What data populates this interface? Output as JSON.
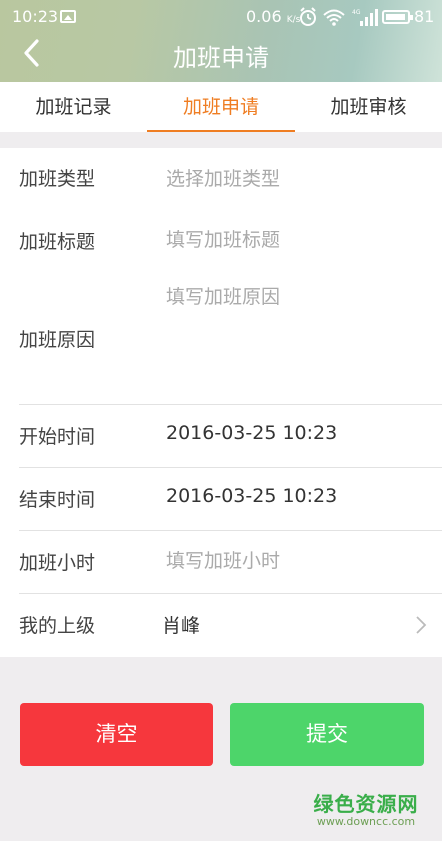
{
  "status_bar": {
    "time": "10:23",
    "net_speed": "0.06",
    "net_unit": "K/s",
    "signal_tag": "4G",
    "battery": "81"
  },
  "nav": {
    "title": "加班申请",
    "back_icon": "chevron-left-icon"
  },
  "tabs": [
    {
      "label": "加班记录",
      "active": false
    },
    {
      "label": "加班申请",
      "active": true
    },
    {
      "label": "加班审核",
      "active": false
    }
  ],
  "form": {
    "type": {
      "label": "加班类型",
      "placeholder": "选择加班类型"
    },
    "title": {
      "label": "加班标题",
      "placeholder": "填写加班标题"
    },
    "reason": {
      "label": "加班原因",
      "placeholder": "填写加班原因"
    },
    "start": {
      "label": "开始时间",
      "value": "2016-03-25 10:23"
    },
    "end": {
      "label": "结束时间",
      "value": "2016-03-25 10:23"
    },
    "hours": {
      "label": "加班小时",
      "placeholder": "填写加班小时"
    },
    "superior": {
      "label": "我的上级",
      "value": "肖峰"
    }
  },
  "buttons": {
    "clear": "清空",
    "submit": "提交"
  },
  "watermark": {
    "main": "绿色资源网",
    "sub": "www.downcc.com"
  },
  "colors": {
    "accent": "#ef7d22",
    "clear": "#f6373d",
    "submit": "#4dd56a"
  }
}
